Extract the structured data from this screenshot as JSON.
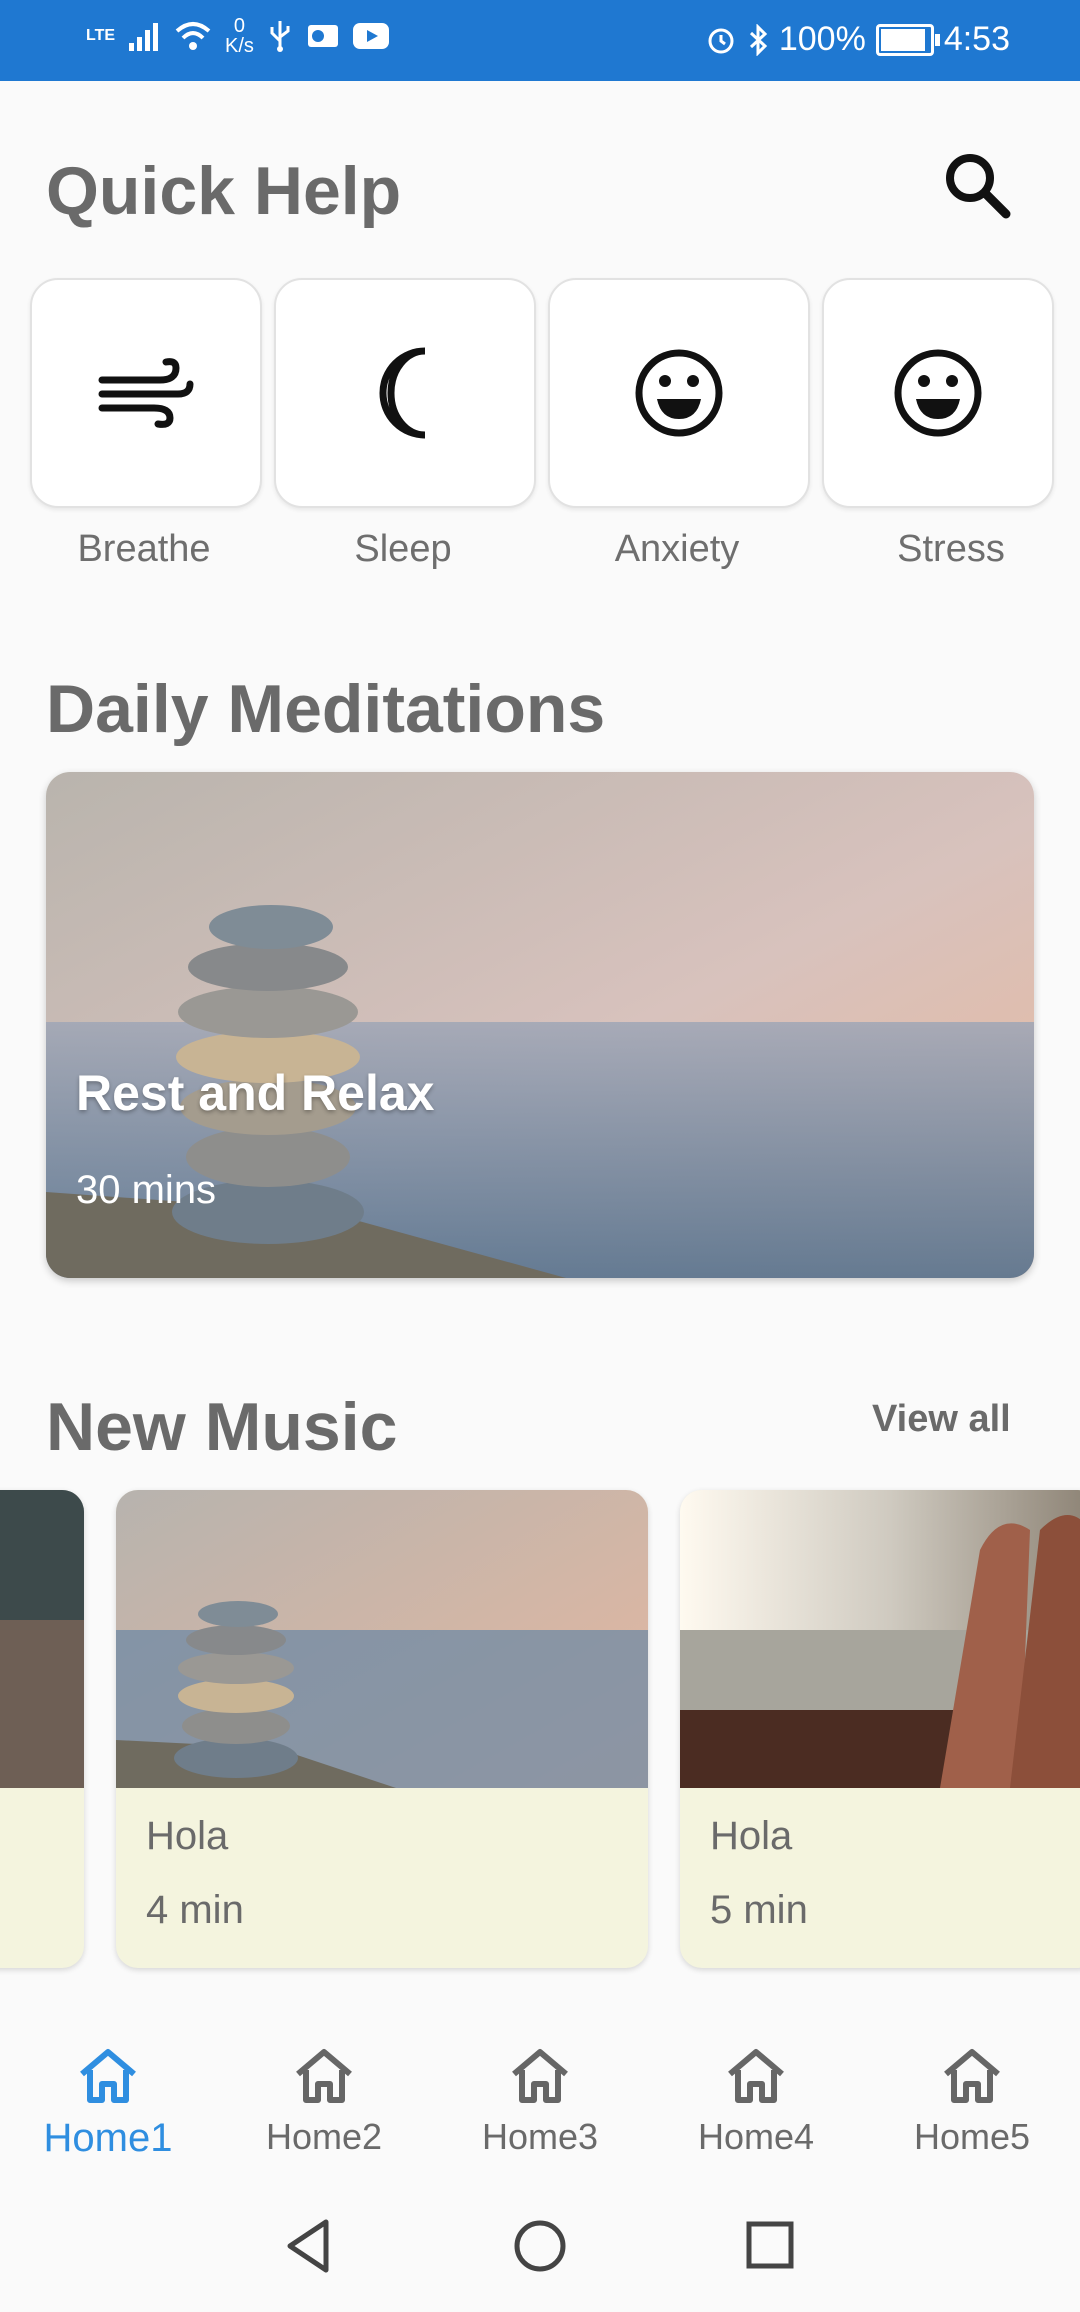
{
  "status_bar": {
    "network": "LTE",
    "speed_value": "0",
    "speed_unit": "K/s",
    "battery": "100%",
    "battery_level": 1.0,
    "time": "4:53"
  },
  "quick_help": {
    "title": "Quick Help",
    "items": [
      {
        "label": "Breathe",
        "icon": "wind-icon"
      },
      {
        "label": "Sleep",
        "icon": "moon-icon"
      },
      {
        "label": "Anxiety",
        "icon": "smiley-icon"
      },
      {
        "label": "Stress",
        "icon": "smiley-icon"
      }
    ]
  },
  "daily_meditations": {
    "title": "Daily Meditations",
    "card": {
      "title": "Rest and Relax",
      "duration": "30 mins"
    }
  },
  "new_music": {
    "title": "New Music",
    "view_all": "View all",
    "items": [
      {
        "title": "Hola",
        "duration": "4 min"
      },
      {
        "title": "Hola",
        "duration": "5 min"
      }
    ]
  },
  "bottom_nav": {
    "items": [
      {
        "label": "Home1",
        "active": true
      },
      {
        "label": "Home2",
        "active": false
      },
      {
        "label": "Home3",
        "active": false
      },
      {
        "label": "Home4",
        "active": false
      },
      {
        "label": "Home5",
        "active": false
      }
    ]
  },
  "colors": {
    "status_bar": "#1f78d1",
    "nav_active": "#2f8ee0",
    "music_card_bg": "#f4f4de",
    "heading": "#6a6a6a"
  }
}
